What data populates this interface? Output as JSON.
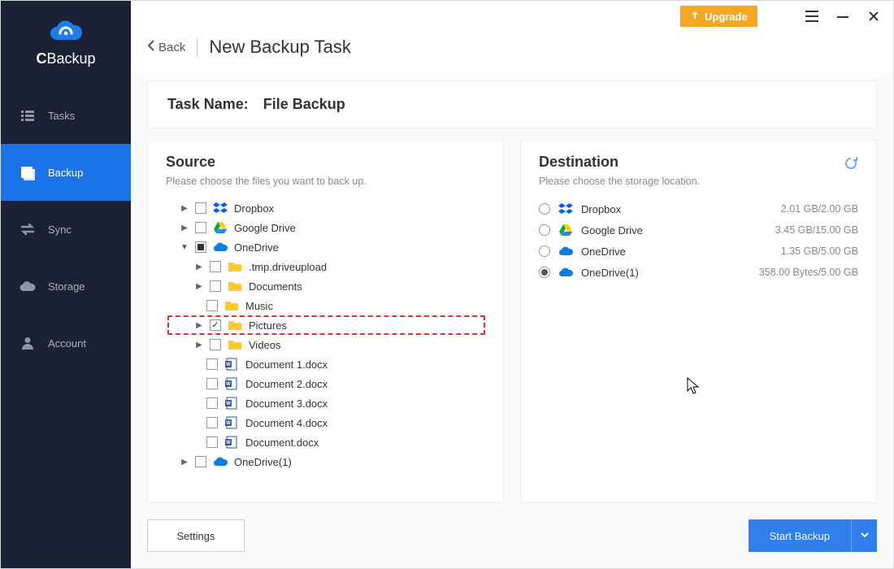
{
  "app": {
    "title": "New Backup Task"
  },
  "brand": {
    "name": "CBackup"
  },
  "titlebar": {
    "upgrade": "Upgrade"
  },
  "header": {
    "back": "Back",
    "title": "New Backup Task"
  },
  "nav": {
    "tasks": {
      "label": "Tasks"
    },
    "backup": {
      "label": "Backup"
    },
    "sync": {
      "label": "Sync"
    },
    "storage": {
      "label": "Storage"
    },
    "account": {
      "label": "Account"
    }
  },
  "task": {
    "name_label": "Task Name:",
    "name_value": "File Backup"
  },
  "source": {
    "title": "Source",
    "subtitle": "Please choose the files you want to back up.",
    "tree": {
      "dropbox": {
        "label": "Dropbox"
      },
      "gdrive": {
        "label": "Google Drive"
      },
      "onedrive": {
        "label": "OneDrive"
      },
      "onedrive1": {
        "label": "OneDrive(1)"
      },
      "tmp": {
        "label": ".tmp.driveupload"
      },
      "documents": {
        "label": "Documents"
      },
      "music": {
        "label": "Music"
      },
      "pictures": {
        "label": "Pictures"
      },
      "videos": {
        "label": "Videos"
      },
      "doc1": {
        "label": "Document 1.docx"
      },
      "doc2": {
        "label": "Document 2.docx"
      },
      "doc3": {
        "label": "Document 3.docx"
      },
      "doc4": {
        "label": "Document 4.docx"
      },
      "doc": {
        "label": "Document.docx"
      }
    }
  },
  "destination": {
    "title": "Destination",
    "subtitle": "Please choose the storage location.",
    "items": [
      {
        "label": "Dropbox",
        "usage": "2.01 GB/2.00 GB"
      },
      {
        "label": "Google Drive",
        "usage": "3.45 GB/15.00 GB"
      },
      {
        "label": "OneDrive",
        "usage": "1.35 GB/5.00 GB"
      },
      {
        "label": "OneDrive(1)",
        "usage": "358.00 Bytes/5.00 GB"
      }
    ]
  },
  "footer": {
    "settings": "Settings",
    "start": "Start Backup"
  }
}
